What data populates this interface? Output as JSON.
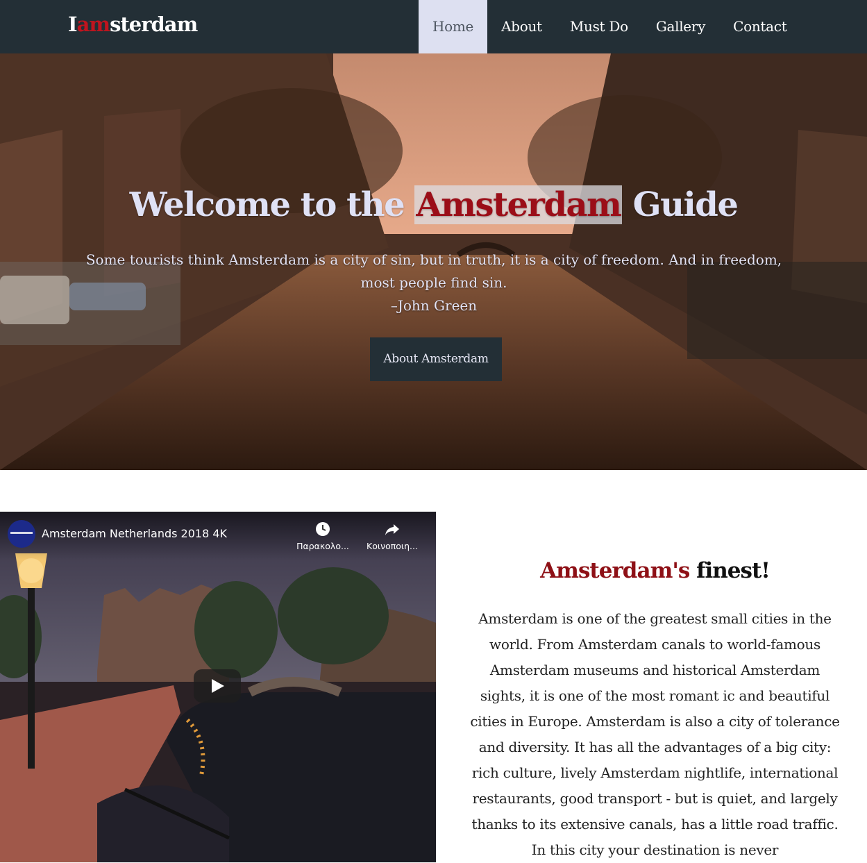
{
  "nav": {
    "logo_prefix": "I",
    "logo_accent": "am",
    "logo_suffix": "sterdam",
    "items": [
      {
        "label": "Home",
        "active": true
      },
      {
        "label": "About"
      },
      {
        "label": "Must Do"
      },
      {
        "label": "Gallery"
      },
      {
        "label": "Contact"
      }
    ]
  },
  "hero": {
    "title_before": "Welcome to the ",
    "title_highlight": "Amsterdam",
    "title_after": " Guide",
    "quote": "Some tourists think Amsterdam is a city of sin, but in truth, it is a city of freedom. And in freedom, most people find sin.",
    "quote_author": "–John Green",
    "button_label": "About Amsterdam"
  },
  "video": {
    "title": "Amsterdam Netherlands 2018 4K",
    "watch_later_label": "Παρακολο...",
    "share_label": "Κοινοποιη...",
    "icons": [
      "clock-icon",
      "share-icon",
      "play-icon"
    ]
  },
  "intro": {
    "heading_accent": "Amsterdam's",
    "heading_rest": " finest!",
    "paragraph": "Amsterdam is one of the greatest small cities in the world. From Amsterdam canals to world-famous Amsterdam museums and historical Amsterdam sights, it is one of the most romant ic and beautiful cities in Europe. Amsterdam is also a city of tolerance and diversity. It has all the advantages of a big city: rich culture, lively Amsterdam nightlife, international restaurants, good transport - but is quiet, and largely thanks to its extensive canals, has a little road traffic. In this city your destination is never"
  },
  "colors": {
    "navbar": "#232f36",
    "accent_red": "#c0141e",
    "active_nav": "#dde0f1",
    "heading_red": "#8e1016"
  }
}
